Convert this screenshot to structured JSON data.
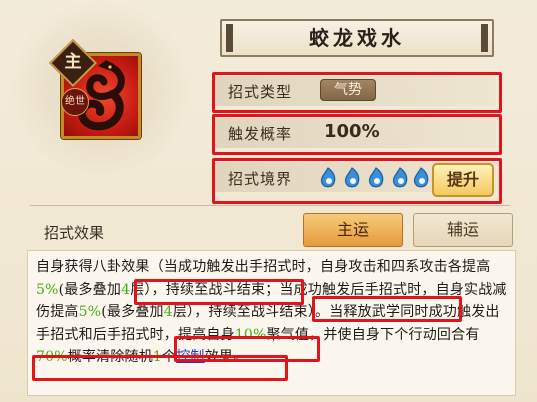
{
  "skill": {
    "name": "蛟龙戏水",
    "badge_main": "主",
    "badge_sub": "绝世"
  },
  "rows": {
    "type_label": "招式类型",
    "type_value": "气势",
    "chance_label": "触发概率",
    "chance_value": "100%",
    "realm_label": "招式境界",
    "realm_level": 5,
    "upgrade_label": "提升"
  },
  "effect": {
    "section_label": "招式效果",
    "tab_main": "主运",
    "tab_aux": "辅运",
    "desc": {
      "p1": "自身获得八卦效果（当成功触发出手招式时，自身攻击和四系攻击各提高",
      "h1": "5%",
      "p2": "(最多叠加",
      "h2": "4",
      "p3": "层），持续至战斗结束；当成功触发后手招式时，自身实战减伤提高",
      "h3": "5%",
      "p4": "(最多叠加",
      "h4": "4",
      "p5": "层），持续至战斗结束）。当释放武学同时成功触发出手招式和后手招式时，提高自身",
      "h5": "10%",
      "p6": "聚气值，并使自身下个行动回合有",
      "h6": "70%",
      "p7": "概率清除随机",
      "h7": "1",
      "p8": "个",
      "link": "控制",
      "p9": "效果。"
    }
  },
  "colors": {
    "highlight_green": "#4caa18",
    "link_blue": "#2236c5",
    "annotation_red": "#e0141a",
    "tab_active": "#e59b3c"
  }
}
